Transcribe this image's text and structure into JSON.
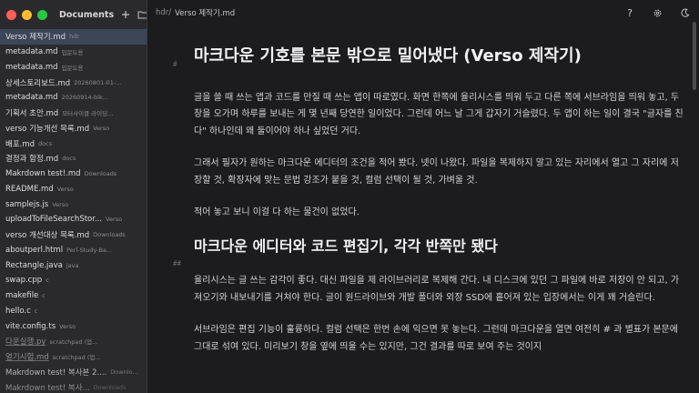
{
  "sidebar": {
    "title": "Documents",
    "files": [
      {
        "name": "Verso 제작기.md",
        "dir": "hdr"
      },
      {
        "name": "metadata.md",
        "dir": "입문도용"
      },
      {
        "name": "metadata.md",
        "dir": "입문도용"
      },
      {
        "name": "상세스토리보드.md",
        "dir": "20260801-01-..."
      },
      {
        "name": "metadata.md",
        "dir": "20260914-bik..."
      },
      {
        "name": "기획서 초안.md",
        "dir": "모터사이클 라이딩..."
      },
      {
        "name": "verso 기능개선 목록.md",
        "dir": "Verso"
      },
      {
        "name": "배포.md",
        "dir": "docs"
      },
      {
        "name": "결정과 함정.md",
        "dir": "docs"
      },
      {
        "name": "Makrdown test!.md",
        "dir": "Downloads"
      },
      {
        "name": "README.md",
        "dir": "Verso"
      },
      {
        "name": "samplejs.js",
        "dir": "Verso"
      },
      {
        "name": "uploadToFileSearchStor...",
        "dir": "Verso"
      },
      {
        "name": "verso 개선대상 목록.md",
        "dir": "Downloads"
      },
      {
        "name": "aboutperl.html",
        "dir": "Perl-Study-Ba..."
      },
      {
        "name": "Rectangle.java",
        "dir": "java"
      },
      {
        "name": "swap.cpp",
        "dir": "c"
      },
      {
        "name": "makefile",
        "dir": "c"
      },
      {
        "name": "hello.c",
        "dir": "c"
      },
      {
        "name": "vite.config.ts",
        "dir": "Verso"
      },
      {
        "name": "다운실행.py",
        "dir": "scratchpad (업..."
      },
      {
        "name": "열기시험.md",
        "dir": "scratchpad (업..."
      },
      {
        "name": "Makrdown test! 복사본 2....",
        "dir": "Downloads"
      },
      {
        "name": "Makrdown test! 복사...",
        "dir": "Downloads"
      }
    ]
  },
  "breadcrumb": {
    "root": "hdr/",
    "file": "Verso 제작기.md"
  },
  "toolbar": {
    "help": "?",
    "settings": "gear-icon",
    "theme": "moon-icon"
  },
  "document": {
    "h1_marker": "#",
    "title": "마크다운 기호를 본문 밖으로 밀어냈다 (Verso 제작기)",
    "p1": "글을 쓸 때 쓰는 앱과 코드를 만질 때 쓰는 앱이 따로였다. 화면 한쪽에 율리시스를 띄워 두고 다른 쪽에 서브라임을 띄워 놓고, 두 창을 오가며 하루를 보내는 게 몇 년째 당연한 일이었다. 그런데 어느 날 그게 갑자기 거슬렸다. 두 앱이 하는 일이 결국 \"글자를 친다\" 하나인데 왜 둘이어야 하나 싶었던 거다.",
    "p2": "그래서 필자가 원하는 마크다운 에디터의 조건을 적어 봤다. 넷이 나왔다. 파일을 복제하지 말고 있는 자리에서 열고 그 자리에 저장할 것, 확장자에 맞는 문법 강조가 붙을 것, 컬럼 선택이 될 것, 가벼울 것.",
    "p3": "적어 놓고 보니 이걸 다 하는 물건이 없었다.",
    "h2_marker": "##",
    "h2": "마크다운 에디터와 코드 편집기, 각각 반쪽만 됐다",
    "p4": "율리시스는 글 쓰는 감각이 좋다. 대신 파일을 제 라이브러리로 복제해 간다. 내 디스크에 있던 그 파일에 바로 저장이 안 되고, 가져오기와 내보내기를 거쳐야 한다. 글이 원드라이브와 개발 폴더와 외장 SSD에 흩어져 있는 입장에서는 이게 꽤 거슬린다.",
    "p5": "서브라임은 편집 기능이 훌륭하다. 컬럼 선택은 한번 손에 익으면 못 놓는다. 그런데 마크다운을 열면 여전히 # 과 별표가 본문에 그대로 섞여 있다. 미리보기 창을 옆에 띄울 수는 있지만, 그건 결과를 따로 보여 주는 것이지"
  }
}
